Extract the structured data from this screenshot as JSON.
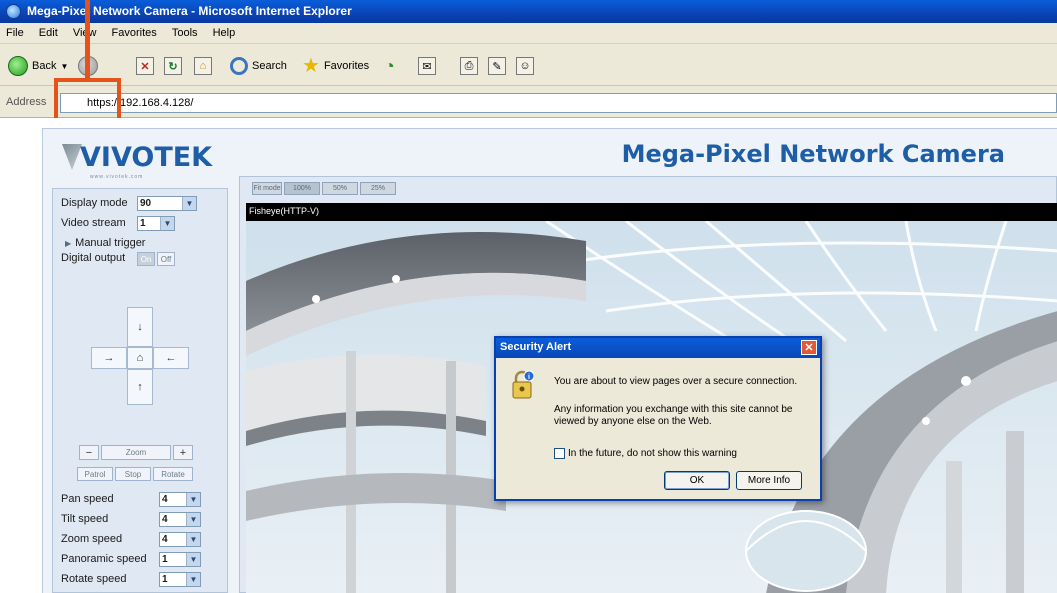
{
  "window": {
    "title": "Mega-Pixel Network Camera - Microsoft Internet Explorer"
  },
  "menu": [
    "File",
    "Edit",
    "View",
    "Favorites",
    "Tools",
    "Help"
  ],
  "toolbar": {
    "back_label": "Back",
    "search_label": "Search",
    "favorites_label": "Favorites"
  },
  "address": {
    "label": "Address",
    "url": "https://192.168.4.128/"
  },
  "page": {
    "logo_text": "VIVOTEK",
    "logo_tagline": "www.vivotek.com",
    "title": "Mega-Pixel Network Camera"
  },
  "controls": {
    "display_mode_label": "Display mode",
    "display_mode_value": "90",
    "video_stream_label": "Video stream",
    "video_stream_value": "1",
    "manual_trigger_label": "Manual trigger",
    "digital_output_label": "Digital output",
    "do_on": "On",
    "do_off": "Off",
    "zoom_minus": "−",
    "zoom_label": "Zoom",
    "zoom_plus": "+",
    "patrol_label": "Patrol",
    "stop_label": "Stop",
    "rotate_label": "Rotate",
    "speeds": [
      {
        "label": "Pan speed",
        "value": "4"
      },
      {
        "label": "Tilt speed",
        "value": "4"
      },
      {
        "label": "Zoom speed",
        "value": "4"
      },
      {
        "label": "Panoramic speed",
        "value": "1"
      },
      {
        "label": "Rotate speed",
        "value": "1"
      }
    ]
  },
  "video": {
    "tabs": [
      "Fit mode",
      "100%",
      "50%",
      "25%"
    ],
    "header": "Fisheye(HTTP-V)"
  },
  "dialog": {
    "title": "Security Alert",
    "message1": "You are about to view pages over a secure connection.",
    "message2": "Any information you exchange with this site cannot be viewed by anyone else on the Web.",
    "checkbox_label": "In the future, do not show this warning",
    "ok_label": "OK",
    "more_info_label": "More Info"
  }
}
